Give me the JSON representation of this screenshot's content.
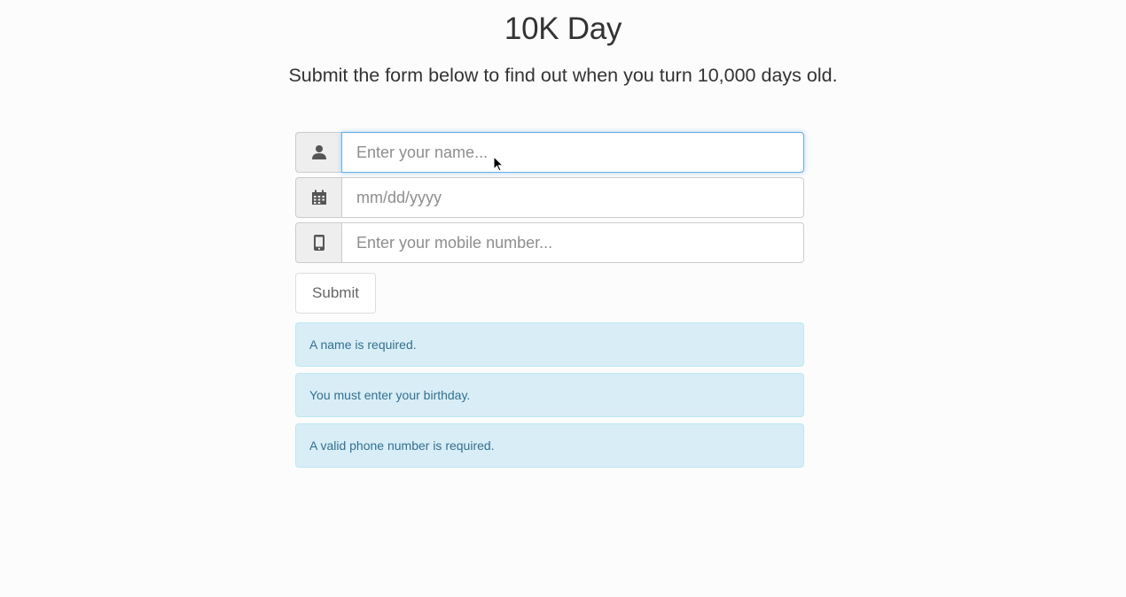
{
  "header": {
    "title": "10K Day",
    "subtitle": "Submit the form below to find out when you turn 10,000 days old."
  },
  "form": {
    "name_field": {
      "placeholder": "Enter your name...",
      "value": "",
      "icon": "user-icon"
    },
    "birthday_field": {
      "placeholder": "mm/dd/yyyy",
      "value": "",
      "icon": "calendar-icon"
    },
    "mobile_field": {
      "placeholder": "Enter your mobile number...",
      "value": "",
      "icon": "mobile-phone-icon"
    },
    "submit_label": "Submit"
  },
  "alerts": [
    {
      "text": "A name is required."
    },
    {
      "text": "You must enter your birthday."
    },
    {
      "text": "A valid phone number is required."
    }
  ],
  "colors": {
    "alert_bg": "#d9edf7",
    "alert_text": "#31708f",
    "focus_border": "#66afe9"
  }
}
